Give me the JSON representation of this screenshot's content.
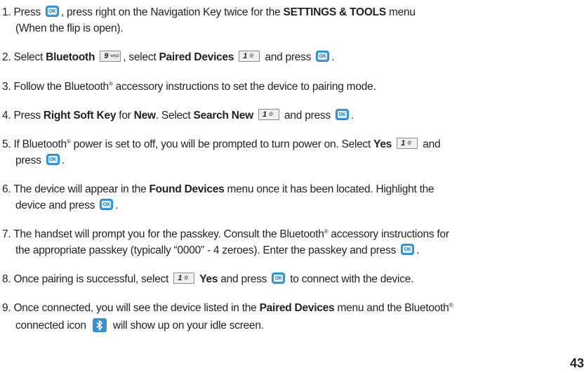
{
  "page_number": "43",
  "icons": {
    "ok_label": "OK",
    "key9_num": "9",
    "key9_sub": "wxyz",
    "key1_num": "1",
    "key1_sub": "@",
    "ok_color": "#3b9ad9",
    "bluetooth_color": "#3e8fce"
  },
  "steps": {
    "s1": {
      "a": "1. Press ",
      "b": ", press right on the Navigation Key twice for the ",
      "c": "SETTINGS & TOOLS",
      "d": " menu",
      "e": "(When the flip is open)."
    },
    "s2": {
      "a": "2. Select ",
      "b": "Bluetooth",
      "c": ", select ",
      "d": "Paired Devices",
      "e": " and press ",
      "f": "."
    },
    "s3": {
      "a": "3. Follow the Bluetooth",
      "sup": "®",
      "b": " accessory instructions to set the device to pairing mode."
    },
    "s4": {
      "a": "4. Press ",
      "b": "Right Soft Key",
      "c": " for ",
      "d": "New",
      "e": ". Select ",
      "f": "Search New",
      "g": " and press ",
      "h": "."
    },
    "s5": {
      "a": "5. If Bluetooth",
      "sup": "®",
      "b": " power is set to off, you will be prompted to turn power on. Select ",
      "c": "Yes",
      "d": " and",
      "e": "press ",
      "f": "."
    },
    "s6": {
      "a": "6. The device will appear in the ",
      "b": "Found Devices",
      "c": " menu once it has been located. Highlight the",
      "d": "device and press ",
      "e": "."
    },
    "s7": {
      "a": "7. The handset will prompt you for the passkey. Consult the Bluetooth",
      "sup": "®",
      "b": " accessory instructions for",
      "c": "the appropriate passkey (typically “0000” - 4 zeroes). Enter the passkey and press ",
      "d": "."
    },
    "s8": {
      "a": "8. Once pairing is successful, select ",
      "b": "Yes",
      "c": " and press ",
      "d": " to connect with the device."
    },
    "s9": {
      "a": "9. Once connected, you will see the device listed in the ",
      "b": "Paired Devices",
      "c": " menu and the Bluetooth",
      "sup": "®",
      "d": "connected icon ",
      "e": " will show up on your idle screen."
    }
  }
}
